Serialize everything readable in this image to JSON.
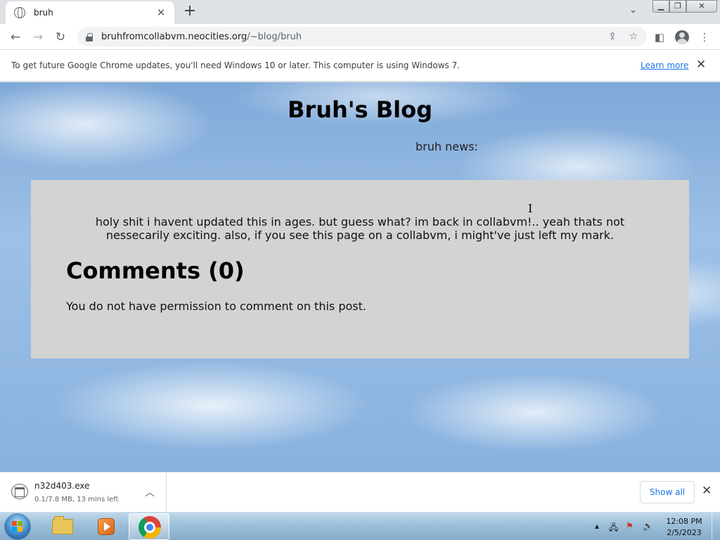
{
  "browser": {
    "tab_title": "bruh",
    "url_domain": "bruhfromcollabvm.neocities.org",
    "url_path": "/~blog/bruh"
  },
  "infobar": {
    "message": "To get future Google Chrome updates, you'll need Windows 10 or later. This computer is using Windows 7.",
    "learn_more": "Learn more"
  },
  "page": {
    "title": "Bruh's Blog",
    "subtitle": "bruh news:",
    "post_text": "holy shit i havent updated this in ages. but guess what? im back in collabvm!.. yeah thats not nessecarily exciting. also, if you see this page on a collabvm, i might've just left my mark.",
    "comments_heading": "Comments (0)",
    "comments_note": "You do not have permission to comment on this post."
  },
  "downloads": {
    "filename": "n32d403.exe",
    "status": "0.1/7.8 MB, 13 mins left",
    "show_all": "Show all"
  },
  "taskbar": {
    "time": "12:08 PM",
    "date": "2/5/2023"
  },
  "colors": {
    "link": "#1a73e8",
    "post_box": "#d3d3d3"
  }
}
